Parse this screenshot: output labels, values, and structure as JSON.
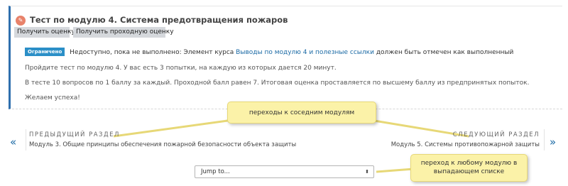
{
  "activity": {
    "icon": "quiz-icon",
    "title": "Тест по модулю 4. Система предотвращения пожаров",
    "buttons": [
      "Получить оценку",
      "Получить проходную оценку"
    ],
    "restriction": {
      "badge": "Ограничено",
      "text_before": "Недоступно, пока не выполнено: Элемент курса",
      "link": "Выводы по модулю 4 и полезные ссылки",
      "text_after": "должен быть отмечен как выполненный"
    },
    "description": [
      "Пройдите тест по модулю 4. У вас есть 3 попытки, на каждую из которых дается 20 минут.",
      "В тесте 10 вопросов по 1 баллу за каждый. Проходной балл равен 7. Итоговая оценка проставляется по высшему баллу из предпринятых попыток.",
      "Желаем успеха!"
    ]
  },
  "callouts": {
    "neighbors": "переходы к соседним модулям",
    "any_module_line1": "переход к любому модулю в",
    "any_module_line2": "выпадающем списке"
  },
  "nav": {
    "prev_arrow": "«",
    "next_arrow": "»",
    "prev_heading": "ПРЕДЫДУЩИЙ РАЗДЕЛ",
    "prev_link": "Модуль 3. Общие принципы обеспечения пожарной безопасности объекта защиты",
    "next_heading": "СЛЕДУЮЩИЙ РАЗДЕЛ",
    "next_link": "Модуль 5. Системы противопожарной защиты"
  },
  "jump_to": {
    "selected": "Jump to...",
    "caret": "⬍"
  },
  "colors": {
    "accent": "#2f6fae",
    "badge": "#2b8fc7",
    "link": "#1b6aa5",
    "callout_bg": "#fbf2a8"
  }
}
